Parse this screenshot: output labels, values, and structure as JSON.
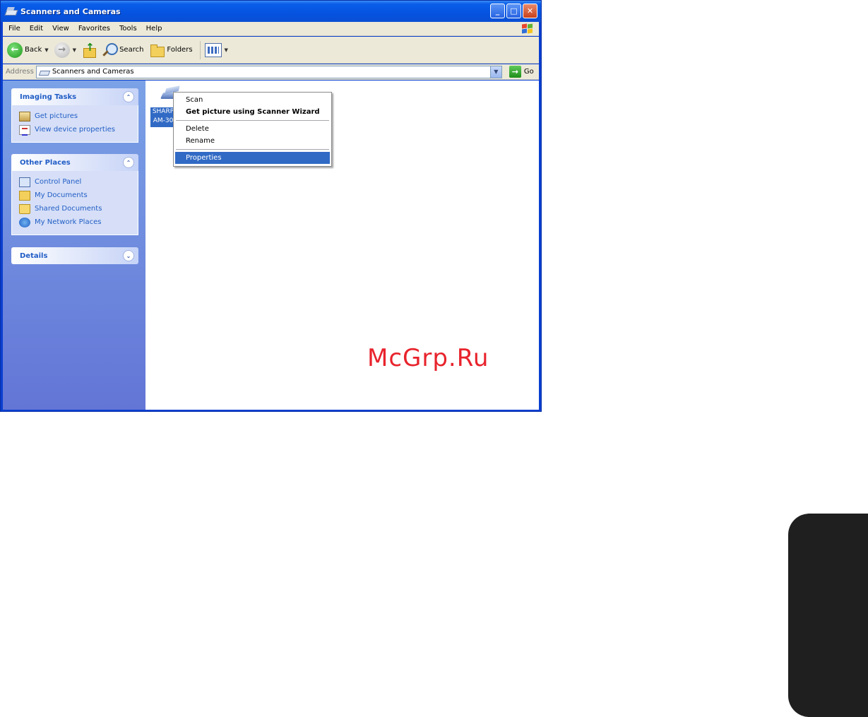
{
  "window": {
    "title": "Scanners and Cameras",
    "controls": {
      "minimize": "_",
      "maximize": "□",
      "close": "✕"
    }
  },
  "menubar": {
    "items": [
      "File",
      "Edit",
      "View",
      "Favorites",
      "Tools",
      "Help"
    ]
  },
  "toolbar": {
    "back_label": "Back",
    "search_label": "Search",
    "folders_label": "Folders"
  },
  "address": {
    "label": "Address",
    "value": "Scanners and Cameras",
    "go_label": "Go"
  },
  "taskpane": {
    "imaging_tasks": {
      "title": "Imaging Tasks",
      "items": [
        "Get pictures",
        "View device properties"
      ]
    },
    "other_places": {
      "title": "Other Places",
      "items": [
        "Control Panel",
        "My Documents",
        "Shared Documents",
        "My Network Places"
      ]
    },
    "details": {
      "title": "Details"
    }
  },
  "content": {
    "device_label": "SHARP AM-30"
  },
  "context_menu": {
    "items": [
      "Scan",
      "Get picture using Scanner Wizard",
      "Delete",
      "Rename",
      "Properties"
    ],
    "selected": "Properties"
  },
  "watermark": "McGrp.Ru",
  "colors": {
    "titlebar": "#0553e0",
    "selection": "#316ac5",
    "task_link": "#215dc6",
    "watermark": "#e8232c"
  }
}
